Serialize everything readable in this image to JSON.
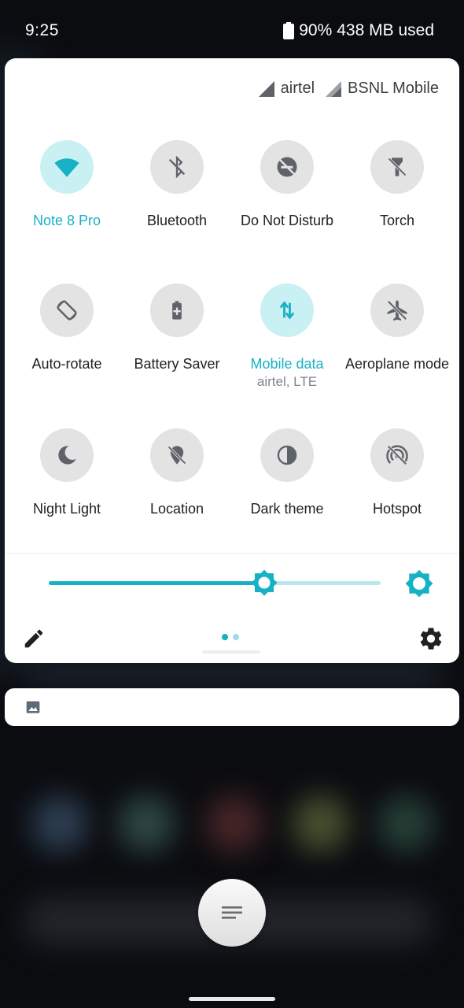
{
  "status_bar": {
    "time": "9:25",
    "battery_percent": "90%",
    "memory": "438 MB used"
  },
  "carriers": [
    {
      "name": "airtel",
      "icon": "signal-icon"
    },
    {
      "name": "BSNL Mobile",
      "icon": "signal-icon"
    }
  ],
  "tiles": [
    {
      "label": "Note 8 Pro",
      "sublabel": "",
      "icon": "wifi-icon",
      "active": true
    },
    {
      "label": "Bluetooth",
      "sublabel": "",
      "icon": "bluetooth-off-icon",
      "active": false
    },
    {
      "label": "Do Not Disturb",
      "sublabel": "",
      "icon": "dnd-icon",
      "active": false
    },
    {
      "label": "Torch",
      "sublabel": "",
      "icon": "torch-off-icon",
      "active": false
    },
    {
      "label": "Auto-rotate",
      "sublabel": "",
      "icon": "rotate-icon",
      "active": false
    },
    {
      "label": "Battery Saver",
      "sublabel": "",
      "icon": "battery-saver-icon",
      "active": false
    },
    {
      "label": "Mobile data",
      "sublabel": "airtel, LTE",
      "icon": "mobile-data-icon",
      "active": true
    },
    {
      "label": "Aeroplane mode",
      "sublabel": "",
      "icon": "airplane-off-icon",
      "active": false
    },
    {
      "label": "Night Light",
      "sublabel": "",
      "icon": "moon-icon",
      "active": false
    },
    {
      "label": "Location",
      "sublabel": "",
      "icon": "location-off-icon",
      "active": false
    },
    {
      "label": "Dark theme",
      "sublabel": "",
      "icon": "dark-theme-icon",
      "active": false
    },
    {
      "label": "Hotspot",
      "sublabel": "",
      "icon": "hotspot-off-icon",
      "active": false
    }
  ],
  "brightness": {
    "level_fraction": 0.65,
    "auto_icon": "auto-brightness-icon"
  },
  "pager": {
    "pages": 2,
    "current": 1
  },
  "colors": {
    "accent": "#17b1c6",
    "tile_off": "#e3e3e3",
    "tile_on": "#c9f0f3"
  }
}
